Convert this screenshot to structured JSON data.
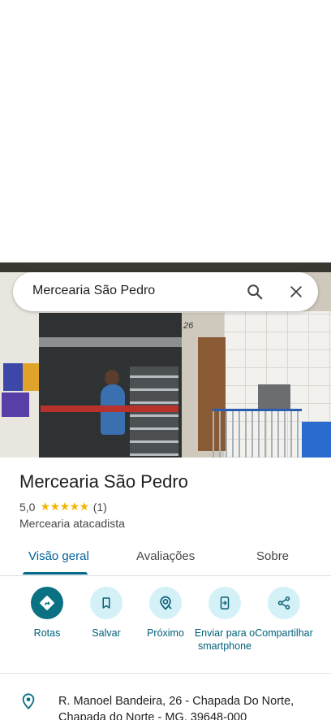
{
  "search": {
    "query": "Mercearia São Pedro"
  },
  "photo": {
    "house_number": "26"
  },
  "place": {
    "name": "Mercearia São Pedro",
    "rating": "5,0",
    "stars": "★★★★★",
    "review_count": "(1)",
    "category": "Mercearia atacadista"
  },
  "tabs": [
    {
      "label": "Visão geral",
      "active": true
    },
    {
      "label": "Avaliações",
      "active": false
    },
    {
      "label": "Sobre",
      "active": false
    }
  ],
  "actions": [
    {
      "label": "Rotas",
      "icon": "directions-icon"
    },
    {
      "label": "Salvar",
      "icon": "bookmark-icon"
    },
    {
      "label": "Próximo",
      "icon": "nearby-icon"
    },
    {
      "label": "Enviar para o smartphone",
      "icon": "send-to-phone-icon"
    },
    {
      "label": "Compartilhar",
      "icon": "share-icon"
    }
  ],
  "address": {
    "text": "R. Manoel Bandeira, 26 - Chapada Do Norte, Chapada do Norte - MG, 39648-000"
  },
  "colors": {
    "accent": "#00639b",
    "action_label": "#00607a",
    "action_bg": "#d4f1f8",
    "primary_action_bg": "#0a7183",
    "star": "#f5b400"
  }
}
